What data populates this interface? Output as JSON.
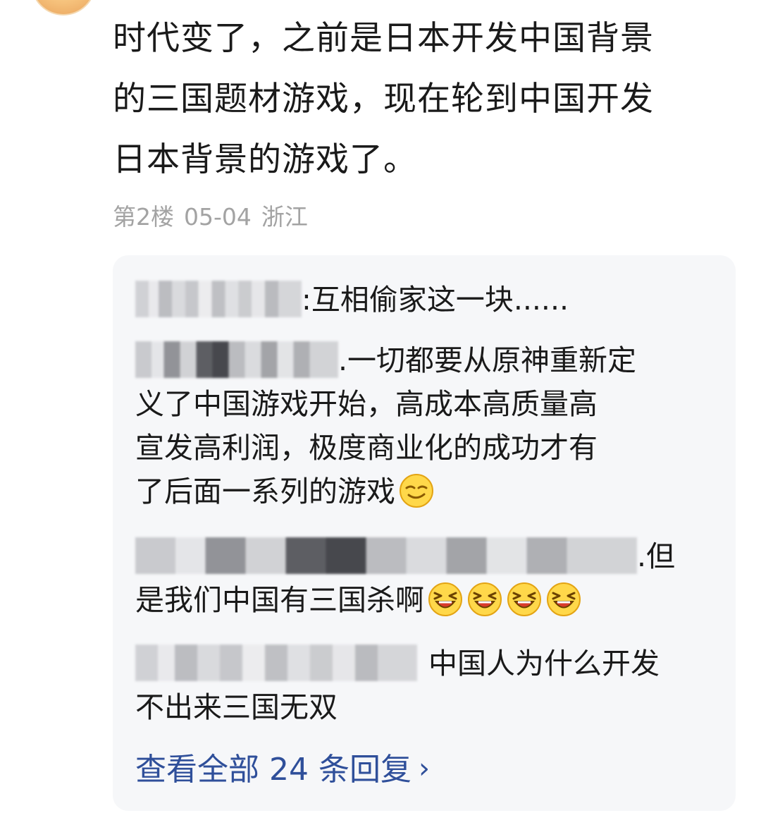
{
  "comment": {
    "line1": "时代变了，之前是日本开发中国背景",
    "line2": "的三国题材游戏，现在轮到中国开发",
    "line3": "日本背景的游戏了。",
    "floor": "第2楼",
    "date": "05-04",
    "location": "浙江"
  },
  "replies": [
    {
      "text": ":互相偷家这一块......"
    },
    {
      "line1": ".一切都要从原神重新定",
      "line2": "义了中国游戏开始，高成本高质量高",
      "line3": "宣发高利润，极度商业化的成功才有",
      "line4": "了后面一系列的游戏",
      "emoji": "smirk-face-icon"
    },
    {
      "line1": ".但",
      "line2": "是我们中国有三国杀啊",
      "emoji": "laughing-face-icon",
      "emoji_count": 4
    },
    {
      "line1": "中国人为什么开发",
      "line2": "不出来三国无双"
    }
  ],
  "view_all": {
    "label": "查看全部 24 条回复",
    "chevron": "›"
  }
}
